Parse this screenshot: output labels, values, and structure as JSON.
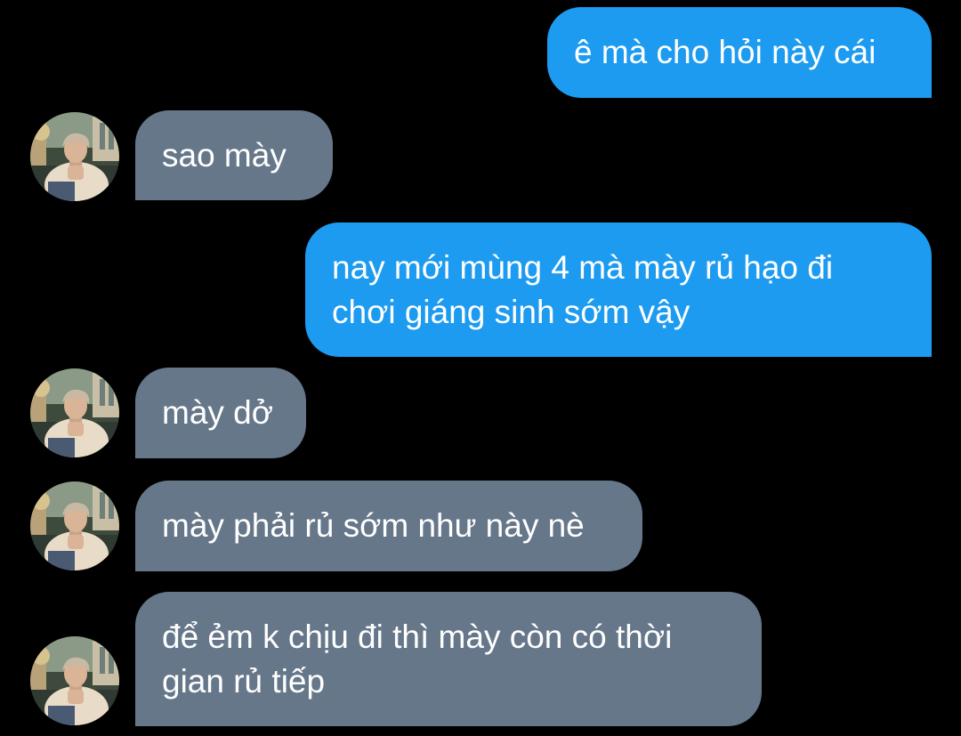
{
  "messages": [
    {
      "sender": "me",
      "text": "ê mà cho hỏi này cái"
    },
    {
      "sender": "them",
      "text": "sao mày"
    },
    {
      "sender": "me",
      "text": "nay mới mùng 4 mà mày rủ hạo đi\nchơi giáng sinh sớm vậy"
    },
    {
      "sender": "them",
      "text": "mày dở"
    },
    {
      "sender": "them",
      "text": "mày phải rủ sớm như này nè"
    },
    {
      "sender": "them",
      "text": "để ẻm k chịu đi thì mày còn có thời\ngian rủ tiếp"
    }
  ],
  "colors": {
    "background": "#000000",
    "outgoing_bubble": "#1d9bf0",
    "incoming_bubble": "#66778a",
    "text": "#ffffff"
  },
  "avatar": {
    "icon": "profile-photo-avatar"
  }
}
